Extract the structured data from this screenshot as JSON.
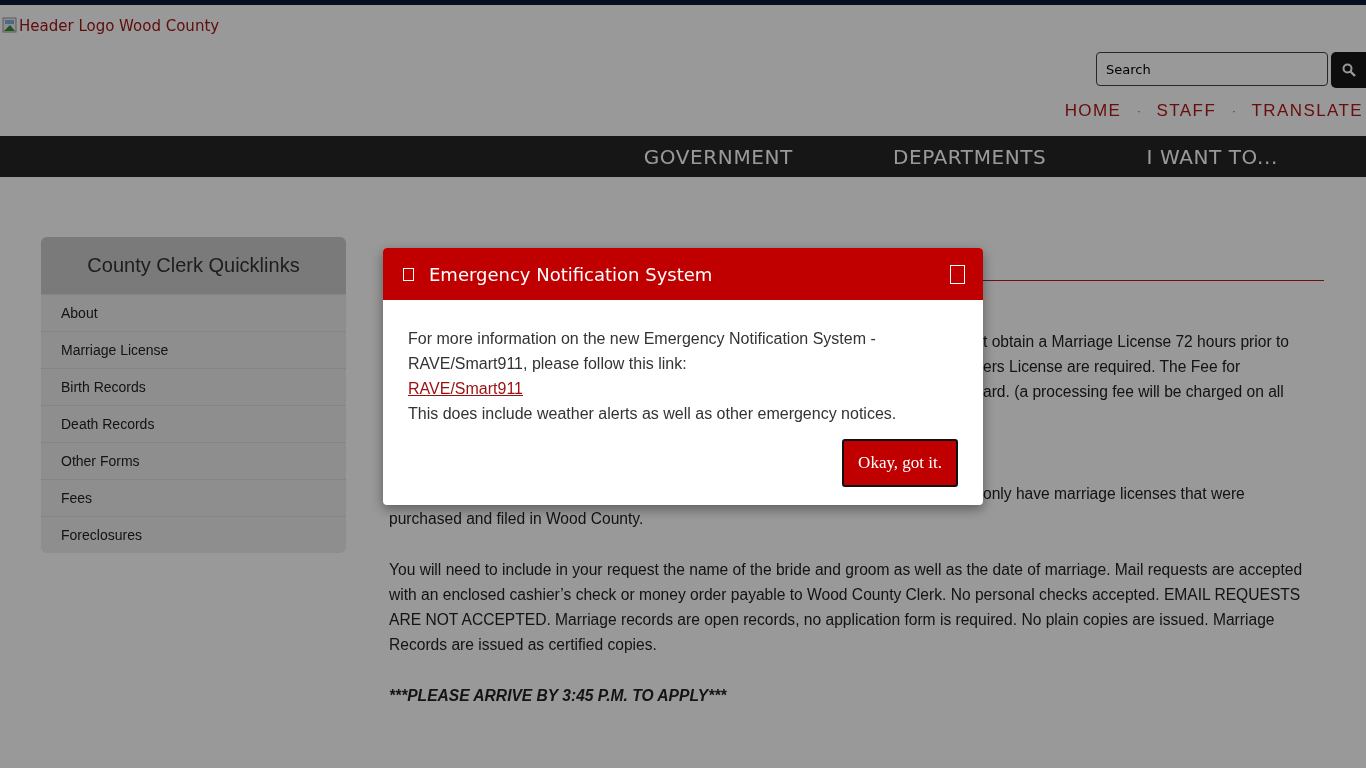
{
  "header": {
    "logo_alt": "Header Logo Wood County",
    "search": {
      "placeholder": "Search"
    },
    "links": [
      "HOME",
      "STAFF",
      "TRANSLATE"
    ],
    "separators": [
      "·",
      "·"
    ]
  },
  "nav": [
    "GOVERNMENT",
    "DEPARTMENTS",
    "I WANT TO..."
  ],
  "sidebar": {
    "title": "County Clerk Quicklinks",
    "items": [
      "About",
      "Marriage License",
      "Birth Records",
      "Death Records",
      "Other Forms",
      "Fees",
      "Foreclosures"
    ]
  },
  "content": {
    "partial_lines": [
      "t obtain a Marriage License 72 hours prior to",
      "ers License are required. The Fee for",
      "ard. (a processing fee will be charged on all"
    ],
    "partial_lines_2": [
      "only have marriage licenses that were"
    ],
    "paragraphs": [
      "purchased and filed in Wood County.",
      "You will need to include in your request the name of the bride and groom as well as the date of marriage. Mail requests are accepted with an enclosed cashier’s check or money order payable to Wood County Clerk. No personal checks accepted. EMAIL REQUESTS ARE NOT ACCEPTED. Marriage records are open records, no application form is required. No plain copies are issued. Marriage Records are issued as certified copies."
    ],
    "notice": "***PLEASE ARRIVE BY 3:45 P.M. TO APPLY***"
  },
  "modal": {
    "title": "Emergency Notification System",
    "intro": "For more information on the new Emergency Notification System - RAVE/Smart911, please follow this link:",
    "link": "RAVE/Smart911",
    "note": "This does include weather alerts as well as other emergency notices.",
    "button": "Okay, got it."
  }
}
